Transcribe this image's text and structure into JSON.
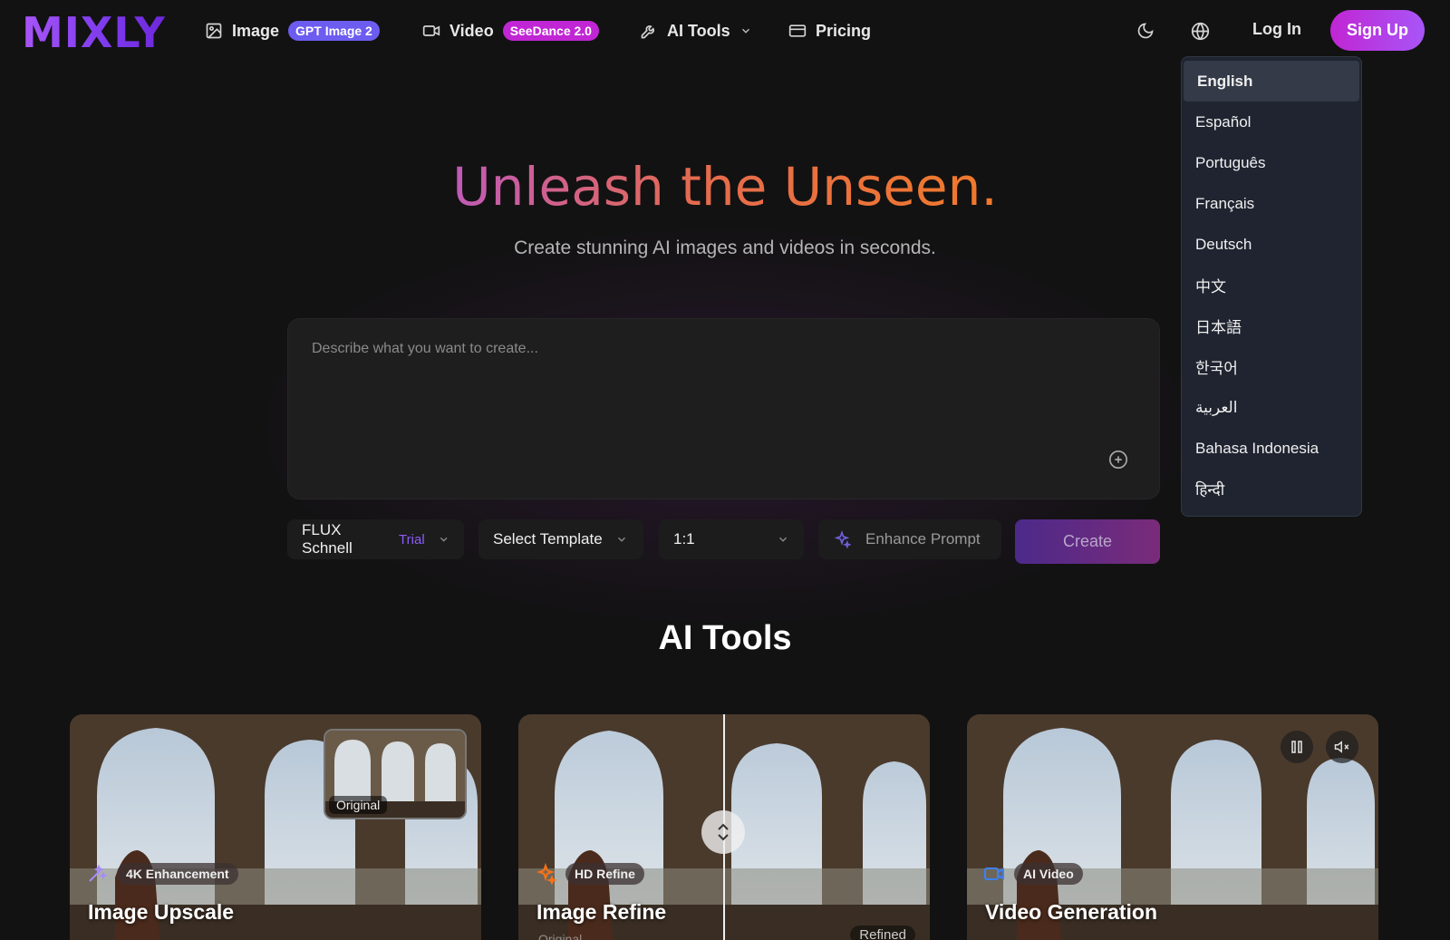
{
  "header": {
    "logo": "MIXLY",
    "nav": [
      {
        "label": "Image",
        "badge": "GPT Image 2",
        "icon": "image-icon"
      },
      {
        "label": "Video",
        "badge": "SeeDance 2.0",
        "icon": "video-icon"
      },
      {
        "label": "AI Tools",
        "icon": "wrench-icon"
      },
      {
        "label": "Pricing",
        "icon": "credit-card-icon"
      }
    ],
    "login": "Log In",
    "signup": "Sign Up"
  },
  "hero": {
    "title": "Unleash the Unseen.",
    "subtitle": "Create stunning AI images and videos in seconds.",
    "prompt_placeholder": "Describe what you want to create..."
  },
  "controls": {
    "model": "FLUX Schnell",
    "model_tag": "Trial",
    "template": "Select Template",
    "ratio": "1:1",
    "enhance": "Enhance Prompt",
    "create": "Create"
  },
  "tools_section": {
    "title": "AI Tools",
    "cards": [
      {
        "badge": "4K Enhancement",
        "title": "Image Upscale",
        "thumb_label": "Original"
      },
      {
        "badge": "HD Refine",
        "title": "Image Refine",
        "left_label": "Original",
        "right_label": "Refined"
      },
      {
        "badge": "AI Video",
        "title": "Video Generation"
      }
    ]
  },
  "language_menu": {
    "selected": "English",
    "items": [
      "English",
      "Español",
      "Português",
      "Français",
      "Deutsch",
      "中文",
      "日本語",
      "한국어",
      "العربية",
      "Bahasa Indonesia",
      "हिन्दी"
    ]
  },
  "colors": {
    "accent": "#a855f7",
    "background": "#121212"
  }
}
